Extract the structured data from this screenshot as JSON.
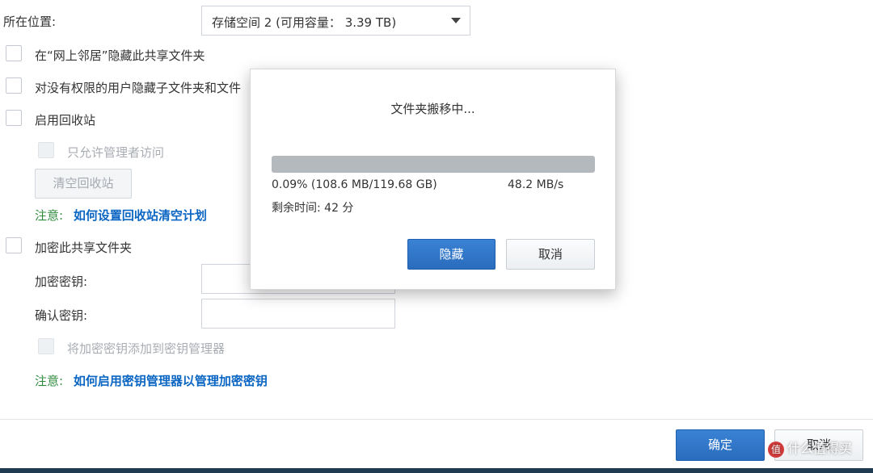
{
  "location": {
    "label": "所在位置:",
    "selected": "存储空间 2 (可用容量： 3.39 TB)"
  },
  "options": {
    "hide_network": "在“网上邻居”隐藏此共享文件夹",
    "hide_subfolders": "对没有权限的用户隐藏子文件夹和文件",
    "enable_recycle": "启用回收站",
    "admin_only": "只允许管理者访问",
    "clear_recycle_button": "清空回收站",
    "recycle_note_prefix": "注意:",
    "recycle_note_link": "如何设置回收站清空计划",
    "encrypt": "加密此共享文件夹",
    "encrypt_key_label": "加密密钥:",
    "confirm_key_label": "确认密钥:",
    "add_key_manager": "将加密密钥添加到密钥管理器",
    "key_note_prefix": "注意:",
    "key_note_link": "如何启用密钥管理器以管理加密密钥"
  },
  "footer": {
    "ok_button": "确定",
    "cancel_button": "取消"
  },
  "dialog": {
    "title": "文件夹搬移中...",
    "progress_fraction": 0.0009,
    "progress_text": "0.09% (108.6 MB/119.68 GB)",
    "speed": "48.2 MB/s",
    "remaining": "剩余时间: 42 分",
    "hide_button": "隐藏",
    "cancel_button": "取消"
  },
  "watermark": {
    "badge": "值",
    "text": "什么值得买"
  },
  "colors": {
    "primary": "#2a6cbd",
    "note_prefix": "#2e8b3e",
    "link": "#0b66c3",
    "progress_fill": "#b4b9be"
  }
}
